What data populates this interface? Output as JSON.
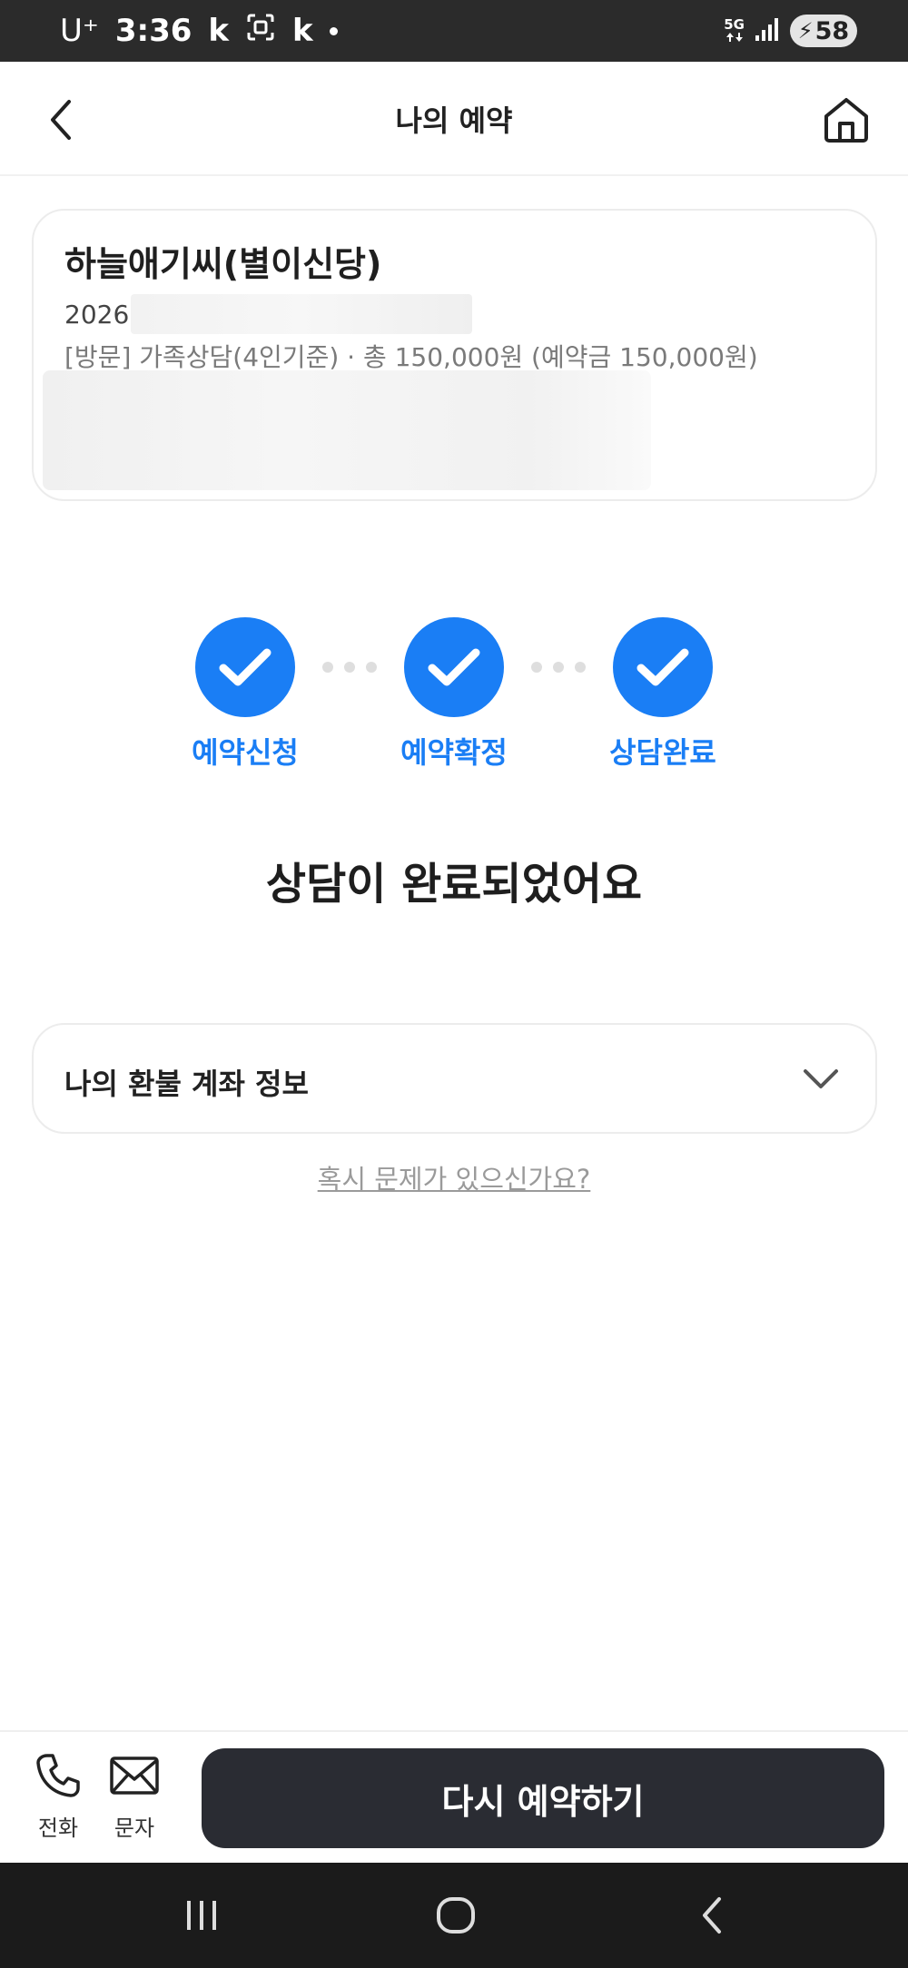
{
  "status_bar": {
    "carrier": "U⁺",
    "time": "3:36",
    "notif_1": "k",
    "notif_2": "k",
    "network": "5G",
    "battery": "58"
  },
  "header": {
    "title": "나의 예약",
    "icons": {
      "back": "chevron-left-icon",
      "home": "home-icon"
    }
  },
  "reservation": {
    "shop_name": "하늘애기씨(별이신당)",
    "date_prefix": "2026",
    "detail": "[방문] 가족상담(4인기준) · 총 150,000원 (예약금 150,000원)"
  },
  "steps": [
    {
      "label": "예약신청",
      "done": true
    },
    {
      "label": "예약확정",
      "done": true
    },
    {
      "label": "상담완료",
      "done": true
    }
  ],
  "status_message": "상담이 완료되었어요",
  "refund": {
    "title": "나의 환불 계좌 정보",
    "icon": "chevron-down-icon"
  },
  "problem_link": "혹시 문제가 있으신가요?",
  "bottom_bar": {
    "call_label": "전화",
    "message_label": "문자",
    "rebook_label": "다시 예약하기"
  },
  "colors": {
    "accent": "#1a7ef5",
    "dark_button": "#2a2c33",
    "status_bar": "#2b2b2b",
    "nav_bar": "#1b1b1b"
  }
}
